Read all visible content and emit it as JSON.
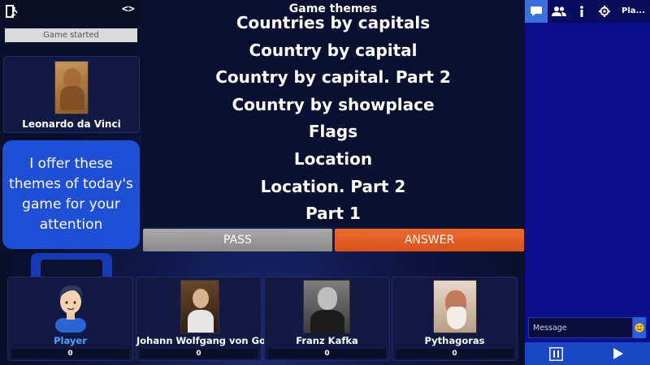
{
  "status": {
    "text": "Game started"
  },
  "host": {
    "name": "Leonardo da Vinci"
  },
  "speech": {
    "text": "I offer these themes of today's game for your attention"
  },
  "board": {
    "title": "Game themes",
    "themes": [
      "Countries by capitals",
      "Country by capital",
      "Country by capital. Part 2",
      "Country by showplace",
      "Flags",
      "Location",
      "Location. Part 2",
      "Part 1"
    ]
  },
  "actions": {
    "pass_label": "PASS",
    "answer_label": "ANSWER"
  },
  "players": [
    {
      "name": "Player",
      "score": "0",
      "name_color": "#4aa3ff",
      "avatar": "cartoon-avatar"
    },
    {
      "name": "Johann Wolfgang von Goethe",
      "score": "0",
      "avatar": "goethe-portrait"
    },
    {
      "name": "Franz Kafka",
      "score": "0",
      "avatar": "kafka-portrait"
    },
    {
      "name": "Pythagoras",
      "score": "0",
      "avatar": "pythagoras-portrait"
    }
  ],
  "panel": {
    "tabs": [
      {
        "icon": "chat-bubble-icon",
        "active": true
      },
      {
        "icon": "users-icon",
        "active": false
      },
      {
        "icon": "info-icon",
        "active": false
      },
      {
        "icon": "gear-icon",
        "active": false
      }
    ],
    "play_tab_label": "Pla...",
    "message_placeholder": "Message",
    "emoji_icon": "smiley-icon",
    "controls": {
      "pause_icon": "pause-icon",
      "play_icon": "play-icon"
    }
  },
  "colors": {
    "accent_blue": "#1f4fd6",
    "answer_orange": "#e35f22",
    "pass_gray": "#9a9a9a",
    "player_name": "#4aa3ff"
  }
}
